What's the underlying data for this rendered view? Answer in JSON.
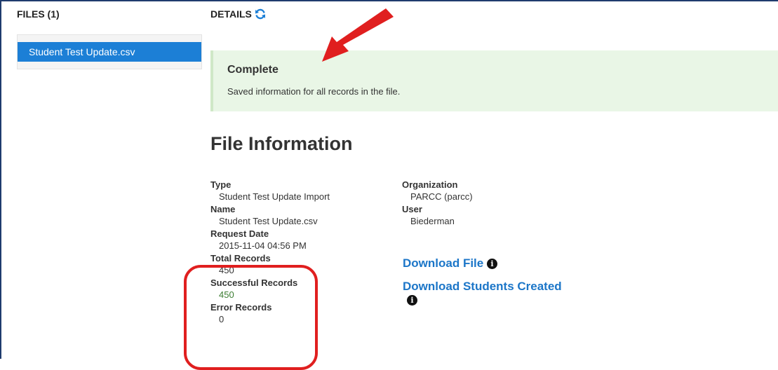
{
  "files": {
    "header": "FILES (1)",
    "items": [
      {
        "label": "Student Test Update.csv",
        "selected": true
      }
    ]
  },
  "details": {
    "header": "DETAILS",
    "refresh_icon": "refresh-icon",
    "alert": {
      "title": "Complete",
      "message": "Saved information for all records in the file."
    },
    "section_title": "File Information",
    "fields": {
      "type_label": "Type",
      "type_value": "Student Test Update Import",
      "name_label": "Name",
      "name_value": "Student Test Update.csv",
      "request_date_label": "Request Date",
      "request_date_value": "2015-11-04 04:56 PM",
      "total_records_label": "Total Records",
      "total_records_value": "450",
      "successful_records_label": "Successful Records",
      "successful_records_value": "450",
      "error_records_label": "Error Records",
      "error_records_value": "0",
      "organization_label": "Organization",
      "organization_value": "PARCC (parcc)",
      "user_label": "User",
      "user_value": "Biederman"
    },
    "links": {
      "download_file": "Download File",
      "download_students_created": "Download Students Created"
    },
    "info_icon": "i"
  },
  "colors": {
    "accent": "#1c7fd6",
    "link": "#1c76c8",
    "success": "#3c7d32",
    "annotation": "#e01f1f"
  }
}
